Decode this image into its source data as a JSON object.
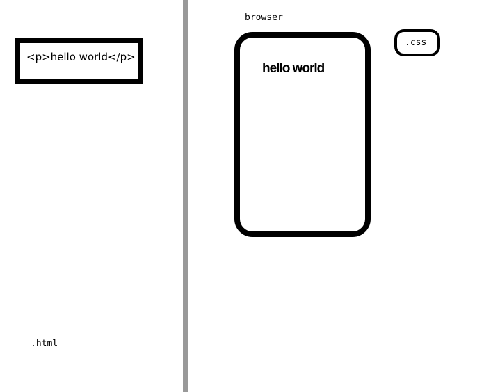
{
  "html_panel": {
    "code": "<p>hello world</p>",
    "file_label": ".html"
  },
  "browser_panel": {
    "label": "browser",
    "rendered_text": "hello world"
  },
  "css_panel": {
    "label": ".css"
  },
  "colors": {
    "divider": "#999999",
    "stroke": "#000000",
    "background": "#ffffff"
  }
}
